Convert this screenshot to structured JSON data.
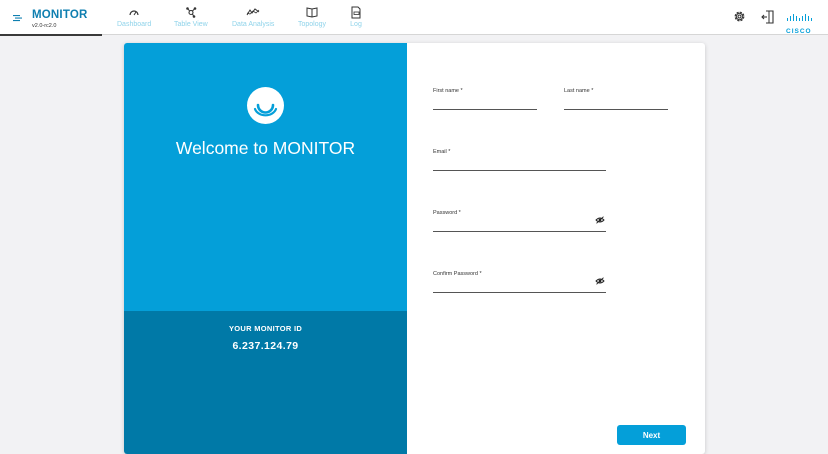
{
  "app": {
    "title": "MONITOR",
    "version": "v2.0-rc2.0"
  },
  "nav": {
    "items": [
      {
        "label": "Dashboard",
        "icon": "gauge-icon"
      },
      {
        "label": "Table View",
        "icon": "network-icon"
      },
      {
        "label": "Data Analysis",
        "icon": "line-chart-icon"
      },
      {
        "label": "Topology",
        "icon": "book-icon"
      },
      {
        "label": "Log",
        "icon": "log-file-icon"
      }
    ]
  },
  "header_right": {
    "icons": [
      "settings-gear-icon",
      "logout-door-icon",
      "cisco-logo"
    ],
    "brand_text": "CISCO"
  },
  "welcome": {
    "heading": "Welcome to MONITOR",
    "id_label": "YOUR MONITOR ID",
    "id_value": "6.237.124.79"
  },
  "form": {
    "first_name": {
      "label": "First name *",
      "value": ""
    },
    "last_name": {
      "label": "Last name *",
      "value": ""
    },
    "email": {
      "label": "Email *",
      "value": ""
    },
    "password": {
      "label": "Password *",
      "value": ""
    },
    "confirm_password": {
      "label": "Confirm Password *",
      "value": ""
    },
    "next_label": "Next"
  },
  "colors": {
    "accent": "#049fd9",
    "accent_dark": "#0079a7",
    "brand_text": "#0f7fb0",
    "nav_text": "#8fd3ea",
    "background": "#f2f2f4"
  }
}
